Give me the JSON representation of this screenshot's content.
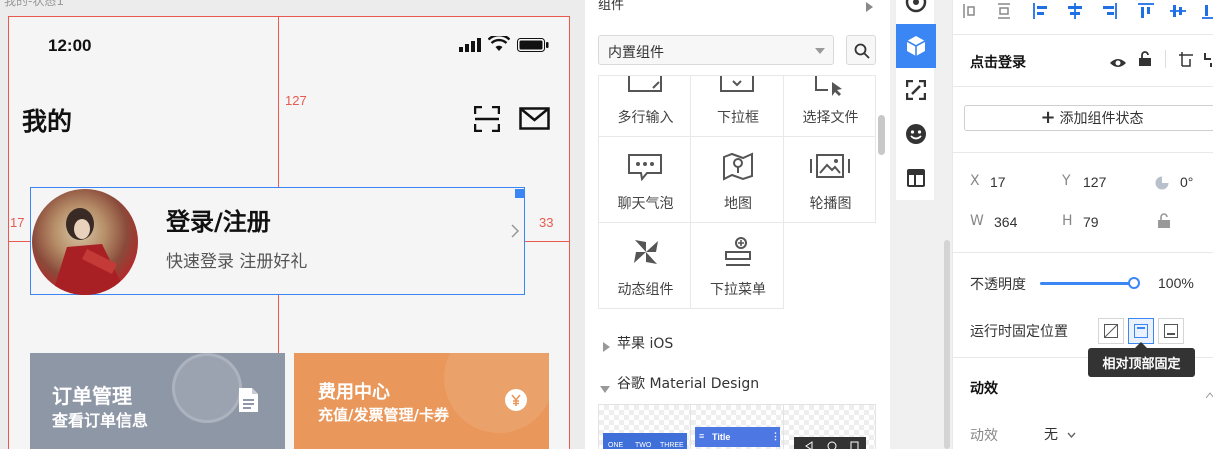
{
  "canvas": {
    "page_tab": "我的-状态1",
    "guides": {
      "top": "127",
      "left": "17",
      "right": "33"
    },
    "status": {
      "time": "12:00"
    },
    "page": {
      "title": "我的",
      "login": {
        "title": "登录/注册",
        "subtitle": "快速登录 注册好礼"
      },
      "cards": [
        {
          "title": "订单管理",
          "subtitle": "查看订单信息",
          "icon": "document-icon",
          "color": "#8e97a6"
        },
        {
          "title": "费用中心",
          "subtitle": "充值/发票管理/卡券",
          "icon": "yen-icon",
          "color": "#e9975a"
        }
      ]
    }
  },
  "component_panel": {
    "header": "组件",
    "select_value": "内置组件",
    "items": [
      {
        "label": "多行输入",
        "icon": "textarea-icon"
      },
      {
        "label": "下拉框",
        "icon": "dropdown-icon"
      },
      {
        "label": "选择文件",
        "icon": "file-select-icon"
      },
      {
        "label": "聊天气泡",
        "icon": "chat-bubble-icon"
      },
      {
        "label": "地图",
        "icon": "map-icon"
      },
      {
        "label": "轮播图",
        "icon": "carousel-icon"
      },
      {
        "label": "动态组件",
        "icon": "pinwheel-icon"
      },
      {
        "label": "下拉菜单",
        "icon": "dropdown-menu-icon"
      }
    ],
    "groups": [
      {
        "label": "苹果 iOS",
        "expanded": false
      },
      {
        "label": "谷歌 Material Design",
        "expanded": true
      }
    ],
    "thumbs": {
      "tabs": [
        "ONE",
        "TWO",
        "THREE"
      ],
      "toolbar_title": "Title"
    }
  },
  "sidebar_icons": [
    "target-icon",
    "cube-icon",
    "scan-icon",
    "emoji-icon",
    "layout-icon"
  ],
  "properties": {
    "component_name": "点击登录",
    "add_state_label": "添加组件状态",
    "x_label": "X",
    "x": "17",
    "y_label": "Y",
    "y": "127",
    "rotation": "0°",
    "w_label": "W",
    "w": "364",
    "h_label": "H",
    "h": "79",
    "opacity_label": "不透明度",
    "opacity_value": "100%",
    "opacity_fraction": 1.0,
    "fixed_label": "运行时固定位置",
    "tooltip": "相对顶部固定",
    "animation_section": "动效",
    "animation_label": "动效",
    "animation_value": "无",
    "accent": "#3b86f5"
  }
}
